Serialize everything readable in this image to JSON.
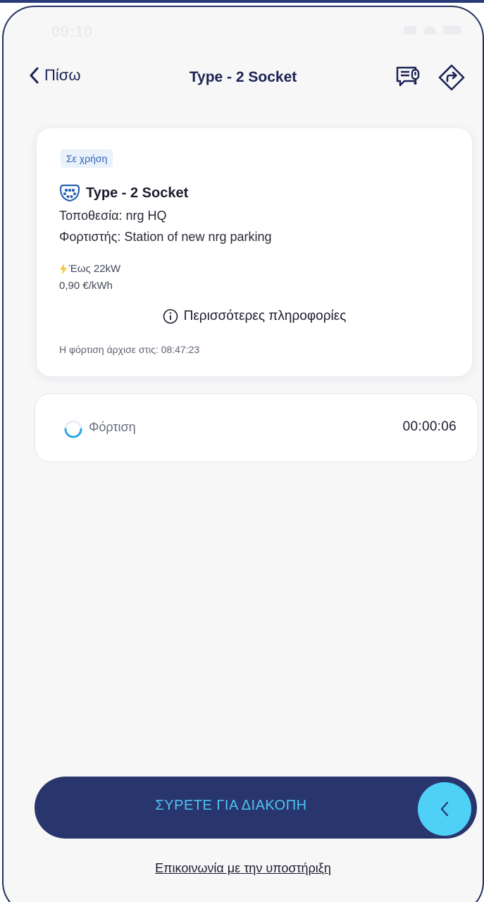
{
  "status_bar": {
    "time": "09:10"
  },
  "nav": {
    "back_label": "Πίσω",
    "title": "Type - 2 Socket",
    "icons": [
      "message-alert-icon",
      "directions-icon"
    ]
  },
  "card": {
    "status_badge": "Σε χρήση",
    "socket_icon": "type2-socket-icon",
    "socket_title": "Type - 2 Socket",
    "location": "Τοποθεσία: nrg HQ",
    "charger": "Φορτιστής: Station of new nrg parking",
    "power_icon": "lightning-icon",
    "power": "Έως 22kW",
    "price": "0,90 €/kWh",
    "more_info": "Περισσότερες πληροφορίες",
    "started": "Η φόρτιση άρχισε στις: 08:47:23"
  },
  "charging": {
    "label": "Φόρτιση",
    "timer": "00:00:06"
  },
  "slider": {
    "label": "ΣΥΡΕΤΕ ΓΙΑ ΔΙΑΚΟΠΗ"
  },
  "support": {
    "label": "Επικοινωνία με την υποστήριξη"
  },
  "colors": {
    "primary_navy": "#29366e",
    "accent_cyan": "#4fd1f7",
    "badge_bg": "#e9f1fb",
    "badge_text": "#2b63b4",
    "lightning": "#f5c842"
  }
}
